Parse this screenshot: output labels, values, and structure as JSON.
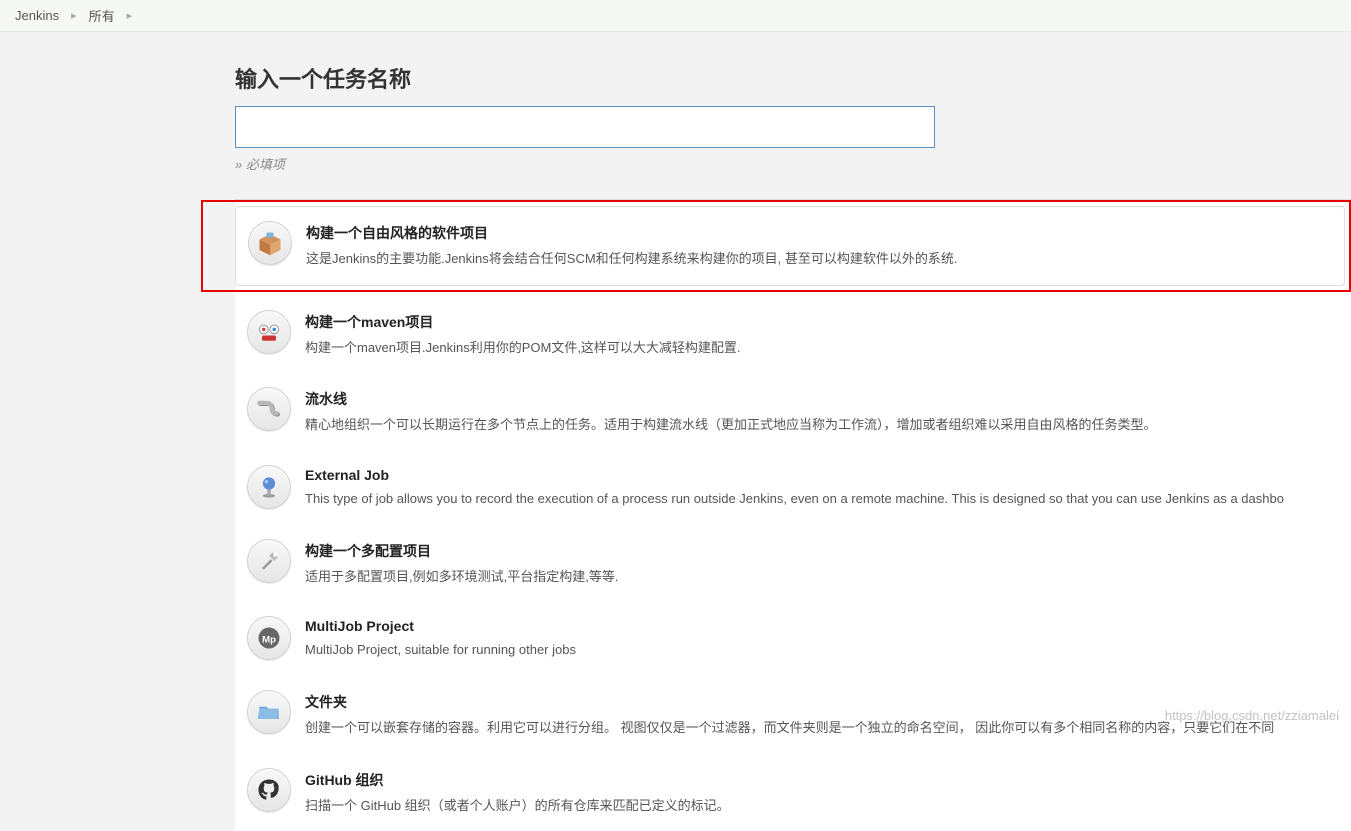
{
  "breadcrumb": {
    "items": [
      "Jenkins",
      "所有"
    ]
  },
  "header": {
    "title": "输入一个任务名称",
    "required_hint": "» 必填项"
  },
  "job_types": [
    {
      "title": "构建一个自由风格的软件项目",
      "desc": "这是Jenkins的主要功能.Jenkins将会结合任何SCM和任何构建系统来构建你的项目, 甚至可以构建软件以外的系统.",
      "selected": true
    },
    {
      "title": "构建一个maven项目",
      "desc": "构建一个maven项目.Jenkins利用你的POM文件,这样可以大大减轻构建配置."
    },
    {
      "title": "流水线",
      "desc": "精心地组织一个可以长期运行在多个节点上的任务。适用于构建流水线（更加正式地应当称为工作流），增加或者组织难以采用自由风格的任务类型。"
    },
    {
      "title": "External Job",
      "desc": "This type of job allows you to record the execution of a process run outside Jenkins, even on a remote machine. This is designed so that you can use Jenkins as a dashbo"
    },
    {
      "title": "构建一个多配置项目",
      "desc": "适用于多配置项目,例如多环境测试,平台指定构建,等等."
    },
    {
      "title": "MultiJob Project",
      "desc": "MultiJob Project, suitable for running other jobs"
    },
    {
      "title": "文件夹",
      "desc": "创建一个可以嵌套存储的容器。利用它可以进行分组。 视图仅仅是一个过滤器，而文件夹则是一个独立的命名空间， 因此你可以有多个相同名称的内容，只要它们在不同"
    },
    {
      "title": "GitHub 组织",
      "desc": "扫描一个 GitHub 组织（或者个人账户）的所有仓库来匹配已定义的标记。"
    }
  ],
  "watermark": "https://blog.csdn.net/zziamalei"
}
